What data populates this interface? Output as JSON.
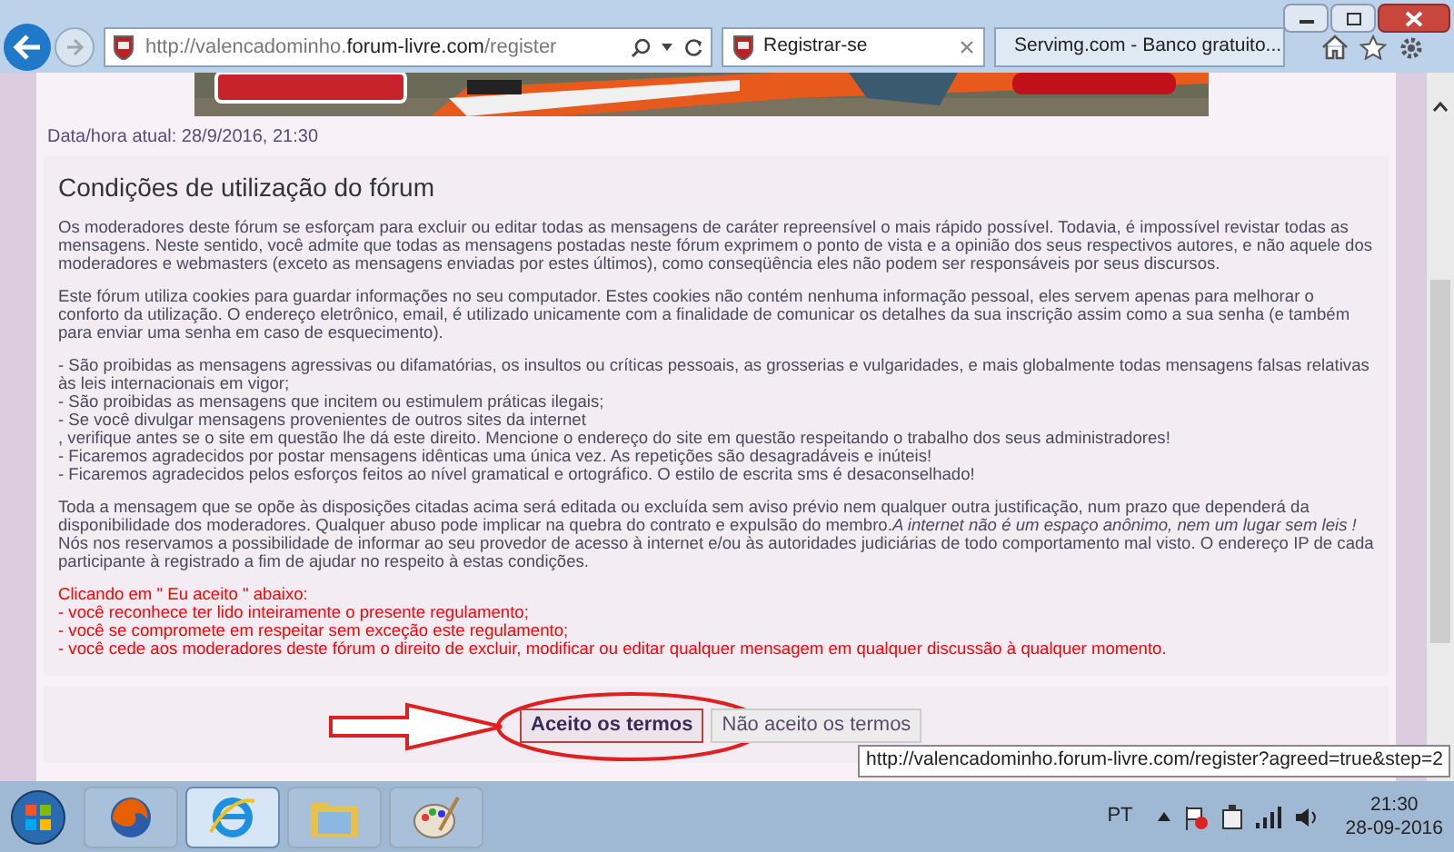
{
  "browser": {
    "address": {
      "prefix": "http://valencadominho.",
      "domain": "forum-livre.com",
      "suffix": "/register"
    },
    "tabs": [
      {
        "title": "Registrar-se",
        "selected": true
      },
      {
        "title": "Servimg.com - Banco gratuito...",
        "selected": false
      }
    ]
  },
  "page": {
    "datetime": "Data/hora atual: 28/9/2016, 21:30",
    "title": "Condições de utilização do fórum",
    "blocks": [
      {
        "kind": "normal",
        "lines": [
          "Os moderadores deste fórum se esforçam para excluir ou editar todas as mensagens de caráter repreensível o mais rápido possível. Todavia, é impossível revistar todas as mensagens. Neste sentido, você admite que todas as mensagens postadas neste fórum exprimem o ponto de vista e a opinião dos seus respectivos autores, e não aquele dos moderadores e webmasters (exceto as mensagens enviadas por estes últimos), como conseqüência eles não podem ser responsáveis por seus discursos."
        ]
      },
      {
        "kind": "normal",
        "lines": [
          "Este fórum utiliza cookies para guardar informações no seu computador. Estes cookies não contém nenhuma informação pessoal, eles servem apenas para melhorar o conforto da utilização. O endereço eletrônico, email, é utilizado unicamente com a finalidade de comunicar os detalhes da sua inscrição assim como a sua senha (e também para enviar uma senha em caso de esquecimento)."
        ]
      },
      {
        "kind": "normal",
        "lines": [
          "- São proibidas as mensagens agressivas ou difamatórias, os insultos ou críticas pessoais, as grosserias e vulgaridades, e mais globalmente todas mensagens falsas relativas às leis internacionais em vigor;",
          "- São proibidas as mensagens que incitem ou estimulem práticas ilegais;",
          "- Se você divulgar mensagens provenientes de outros sites da internet",
          ", verifique antes se o site em questão lhe dá este direito. Mencione o endereço do site em questão respeitando o trabalho dos seus administradores!",
          "- Ficaremos agradecidos por postar mensagens idênticas uma única vez. As repetições são desagradáveis e inúteis!",
          "- Ficaremos agradecidos pelos esforços feitos ao nível gramatical e ortográfico. O estilo de escrita sms é desaconselhado!"
        ]
      },
      {
        "kind": "normal",
        "lines": [
          "Toda a mensagem que se opõe às disposições citadas acima será editada ou excluída sem aviso prévio nem qualquer outra justificação, num prazo que dependerá da disponibilidade dos moderadores. Qualquer abuso pode implicar na quebra do contrato e expulsão do membro.*A internet não é um espaço anônimo, nem um lugar sem leis !* Nós nos reservamos a possibilidade de informar ao seu provedor de acesso à internet e/ou às autoridades judiciárias de todo comportamento mal visto. O endereço IP de cada participante à registrado a fim de ajudar no respeito à estas condições."
        ]
      },
      {
        "kind": "warning",
        "lines": [
          "Clicando em \" Eu aceito \" abaixo:",
          "- você reconhece ter lido inteiramente o presente regulamento;",
          "- você se compromete em respeitar sem exceção este regulamento;",
          "- você cede aos moderadores deste fórum o direito de excluir, modificar ou editar qualquer mensagem em qualquer discussão à qualquer momento."
        ]
      }
    ],
    "buttons": [
      {
        "label": "Aceito os termos",
        "selected": true
      },
      {
        "label": "Não aceito os termos",
        "selected": false
      }
    ]
  },
  "status_url": "http://valencadominho.forum-livre.com/register?agreed=true&step=2",
  "taskbar": {
    "apps": [
      {
        "kind": "firefox",
        "selected": false
      },
      {
        "kind": "ie",
        "selected": true
      },
      {
        "kind": "folder",
        "selected": false
      },
      {
        "kind": "paint",
        "selected": false
      }
    ],
    "language": "PT",
    "time": "21:30",
    "date": "28-09-2016"
  }
}
